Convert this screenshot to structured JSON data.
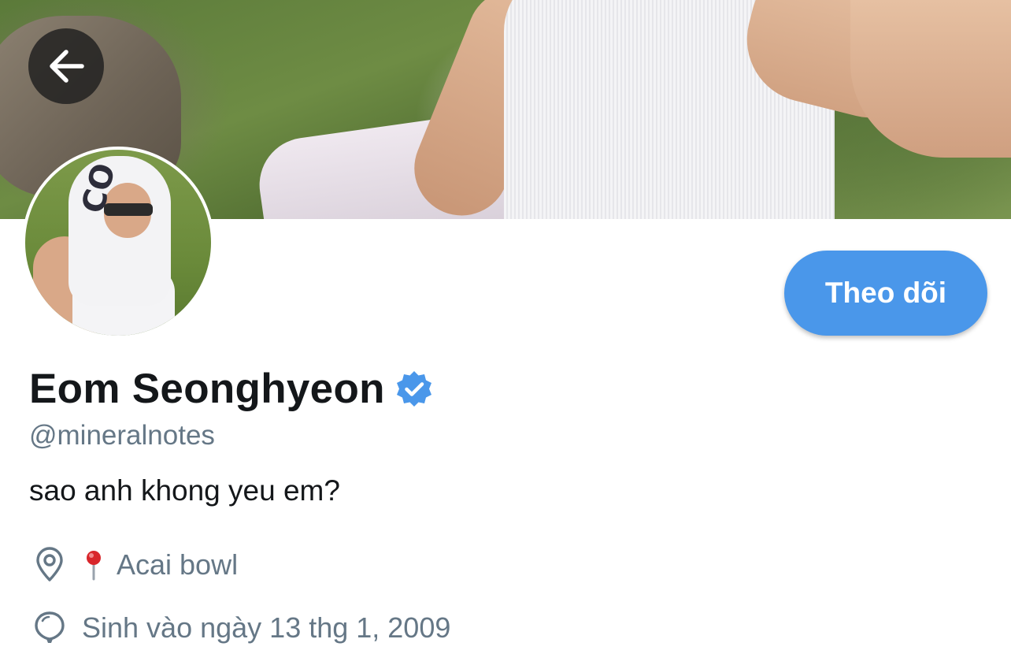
{
  "header": {
    "back_icon": "arrow-left-icon"
  },
  "profile": {
    "display_name": "Eom Seonghyeon",
    "verified_icon": "verified-badge-icon",
    "handle": "@mineralnotes",
    "bio": "sao anh khong yeu em?",
    "location": "Acai bowl",
    "location_icon": "location-pin-icon",
    "location_emoji": "round-pushpin-emoji",
    "birth_date": "Sinh vào ngày 13 thg 1, 2009",
    "birth_icon": "balloon-icon",
    "avatar_text": "CO"
  },
  "actions": {
    "follow_label": "Theo dõi"
  },
  "colors": {
    "accent": "#4a97ea",
    "text_primary": "#14171a",
    "text_secondary": "#657786"
  }
}
